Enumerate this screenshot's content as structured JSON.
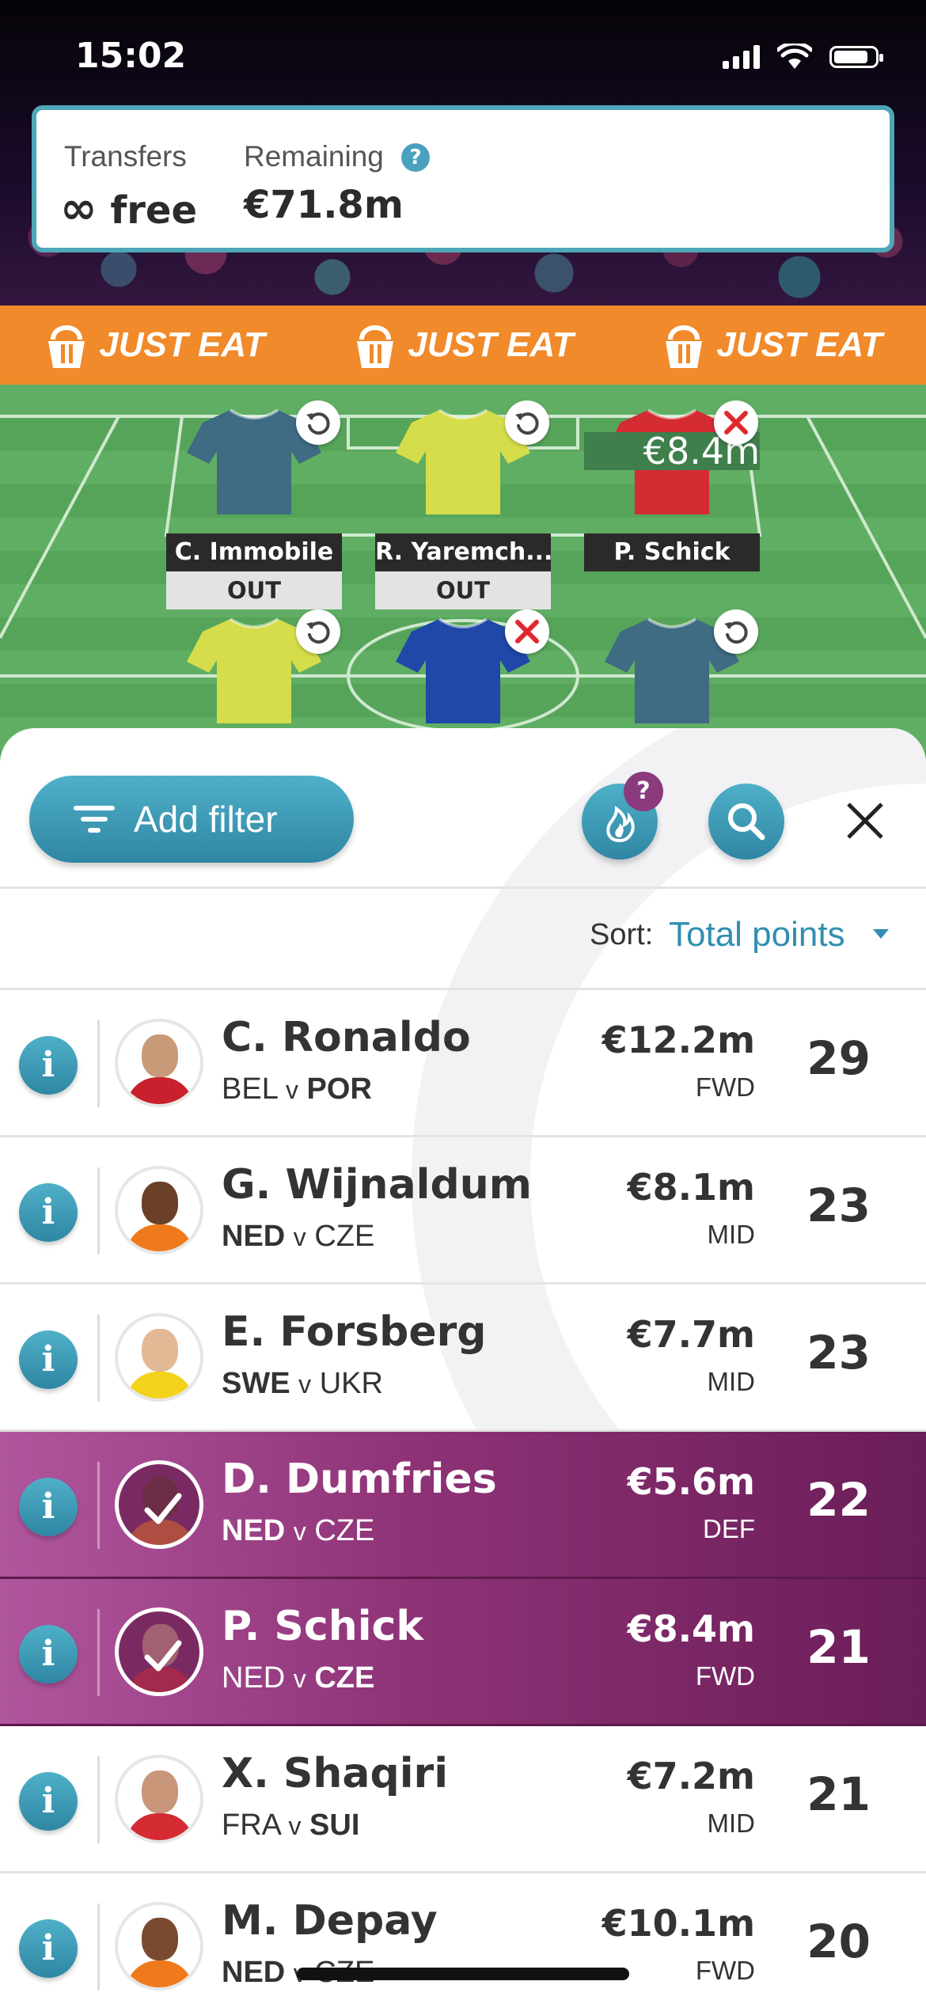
{
  "status_bar": {
    "time": "15:02"
  },
  "transfers": {
    "transfers_label": "Transfers",
    "transfers_symbol": "∞",
    "transfers_value": "free",
    "remaining_label": "Remaining",
    "remaining_value": "€71.8m",
    "help_symbol": "?"
  },
  "sponsor": {
    "text": "JUST EAT"
  },
  "pitch": {
    "slots": [
      {
        "name": "C. Immobile",
        "status": "OUT",
        "shirt_color": "#3f6b83",
        "action": "undo"
      },
      {
        "name": "R. Yaremch...",
        "status": "OUT",
        "shirt_color": "#d6dd4a",
        "action": "undo"
      },
      {
        "name": "P. Schick",
        "status": "€8.4m",
        "shirt_color": "#d52b33",
        "action": "remove"
      },
      {
        "name": "",
        "status": "",
        "shirt_color": "#d6dd4a",
        "action": "undo"
      },
      {
        "name": "",
        "status": "",
        "shirt_color": "#1f48a8",
        "action": "remove"
      },
      {
        "name": "",
        "status": "",
        "shirt_color": "#3f6b83",
        "action": "undo"
      }
    ]
  },
  "toolbar": {
    "filter_label": "Add filter",
    "hot_badge": "?",
    "sort_label": "Sort:",
    "sort_value": "Total points"
  },
  "players": [
    {
      "name": "C. Ronaldo",
      "home": "BEL",
      "away": "POR",
      "bold": "away",
      "price": "€12.2m",
      "position": "FWD",
      "points": "29",
      "selected": false,
      "skin": "#c99a78",
      "kit": "#c8202c"
    },
    {
      "name": "G. Wijnaldum",
      "home": "NED",
      "away": "CZE",
      "bold": "home",
      "price": "€8.1m",
      "position": "MID",
      "points": "23",
      "selected": false,
      "skin": "#6b4028",
      "kit": "#ee7a1c"
    },
    {
      "name": "E. Forsberg",
      "home": "SWE",
      "away": "UKR",
      "bold": "home",
      "price": "€7.7m",
      "position": "MID",
      "points": "23",
      "selected": false,
      "skin": "#e3b995",
      "kit": "#f3d21c"
    },
    {
      "name": "D. Dumfries",
      "home": "NED",
      "away": "CZE",
      "bold": "home",
      "price": "€5.6m",
      "position": "DEF",
      "points": "22",
      "selected": true,
      "skin": "#5b3323",
      "kit": "#ee7a1c"
    },
    {
      "name": "P. Schick",
      "home": "NED",
      "away": "CZE",
      "bold": "away",
      "price": "€8.4m",
      "position": "FWD",
      "points": "21",
      "selected": true,
      "skin": "#d1a384",
      "kit": "#d52b33"
    },
    {
      "name": "X. Shaqiri",
      "home": "FRA",
      "away": "SUI",
      "bold": "away",
      "price": "€7.2m",
      "position": "MID",
      "points": "21",
      "selected": false,
      "skin": "#c9967a",
      "kit": "#d52b33"
    },
    {
      "name": "M. Depay",
      "home": "NED",
      "away": "CZE",
      "bold": "home",
      "price": "€10.1m",
      "position": "FWD",
      "points": "20",
      "selected": false,
      "skin": "#7a4a30",
      "kit": "#ee7a1c"
    }
  ],
  "fixture_separator": "v",
  "info_symbol": "i"
}
